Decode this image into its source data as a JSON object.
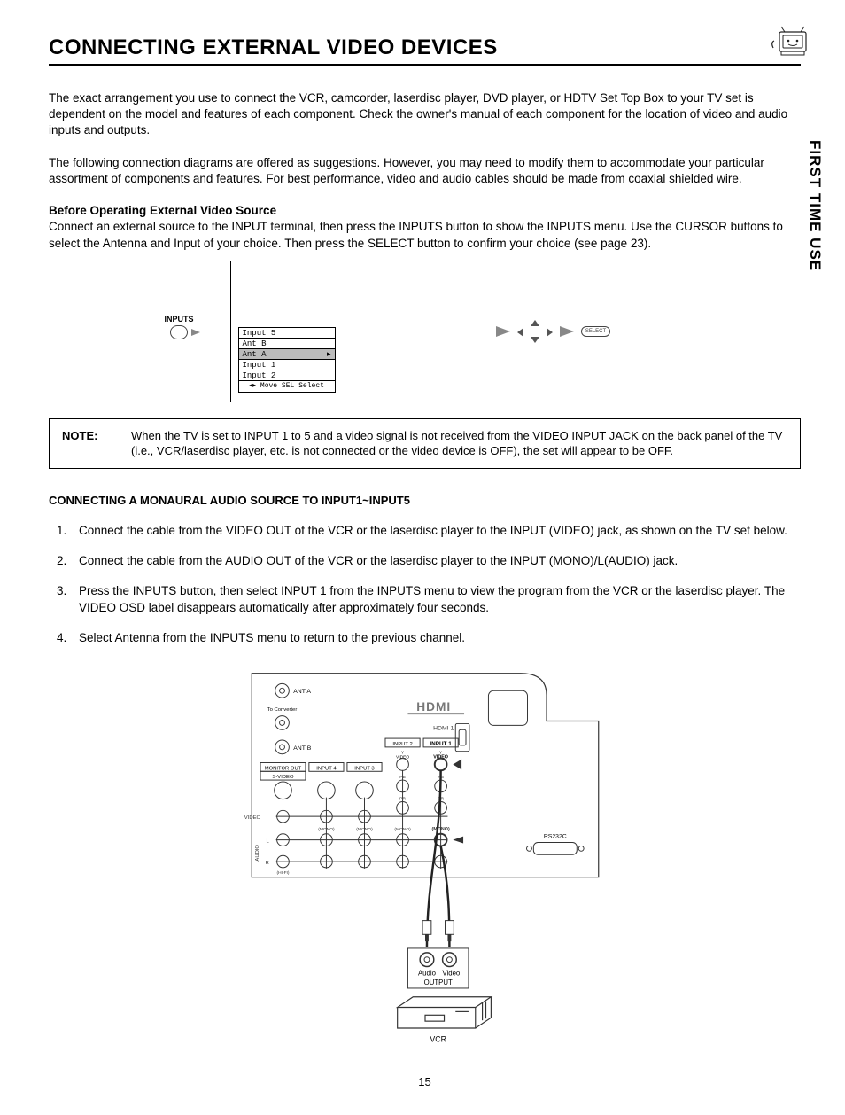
{
  "side_tab": "FIRST TIME USE",
  "title": "CONNECTING EXTERNAL VIDEO DEVICES",
  "intro_p1": "The exact arrangement you use to connect the VCR, camcorder, laserdisc player, DVD player, or HDTV Set Top Box to your TV set is dependent on the model and features of each component.  Check the owner's manual of each component for the location of video and audio inputs and outputs.",
  "intro_p2": "The following connection diagrams are offered as suggestions.  However, you may need to modify them to accommodate your particular assortment of components and features.  For best performance, video and audio cables should be made from coaxial shielded wire.",
  "before_head": "Before Operating External Video Source",
  "before_body": "Connect an external source to the INPUT terminal, then press the INPUTS button to show the INPUTS menu.  Use the CURSOR buttons to select the Antenna and Input of your choice.  Then press the SELECT button to confirm your choice (see page 23).",
  "menu": {
    "button_label": "INPUTS",
    "items": [
      "Input 5",
      "Ant B",
      "Ant A",
      "Input 1",
      "Input 2"
    ],
    "selected": 2,
    "footer": "Move  SEL  Select",
    "select_pill": "SELECT"
  },
  "note": {
    "label": "NOTE:",
    "text": "When the TV is set to INPUT 1 to 5 and a video signal is not received from the VIDEO INPUT JACK on the back panel of the TV (i.e., VCR/laserdisc player, etc. is not connected or the video device is OFF), the set will appear to be OFF."
  },
  "section_head": "CONNECTING A MONAURAL AUDIO SOURCE TO INPUT1~INPUT5",
  "steps": [
    "Connect the cable from the VIDEO OUT of the VCR or the laserdisc player to the INPUT (VIDEO) jack, as shown on the TV set below.",
    "Connect the cable from the AUDIO OUT of the VCR or the laserdisc player to the INPUT (MONO)/L(AUDIO) jack.",
    "Press the INPUTS button, then select INPUT 1 from the INPUTS menu to view the program from the VCR or the laserdisc player. The VIDEO OSD label disappears automatically after approximately four seconds.",
    "Select Antenna from the INPUTS menu to return to the previous channel."
  ],
  "diagram": {
    "hdmi_label": "HDMI",
    "hdmi_port": "HDMI 1",
    "ant_a": "ANT A",
    "ant_b": "ANT B",
    "to_converter": "To Converter",
    "monitor_out": "MONITOR OUT",
    "svideo": "S-VIDEO",
    "input4": "INPUT 4",
    "input3": "INPUT 3",
    "input2": "INPUT 2",
    "input1": "INPUT 1",
    "video": "VIDEO",
    "y": "Y",
    "pb": "PB",
    "pr": "PR",
    "mono": "(MONO)",
    "audio": "AUDIO",
    "l": "L",
    "r": "R",
    "hi_fi": "(HI-FI)",
    "rs232c": "RS232C",
    "audio_out": "Audio",
    "video_out": "Video",
    "output": "OUTPUT",
    "vcr": "VCR"
  },
  "page_number": "15"
}
